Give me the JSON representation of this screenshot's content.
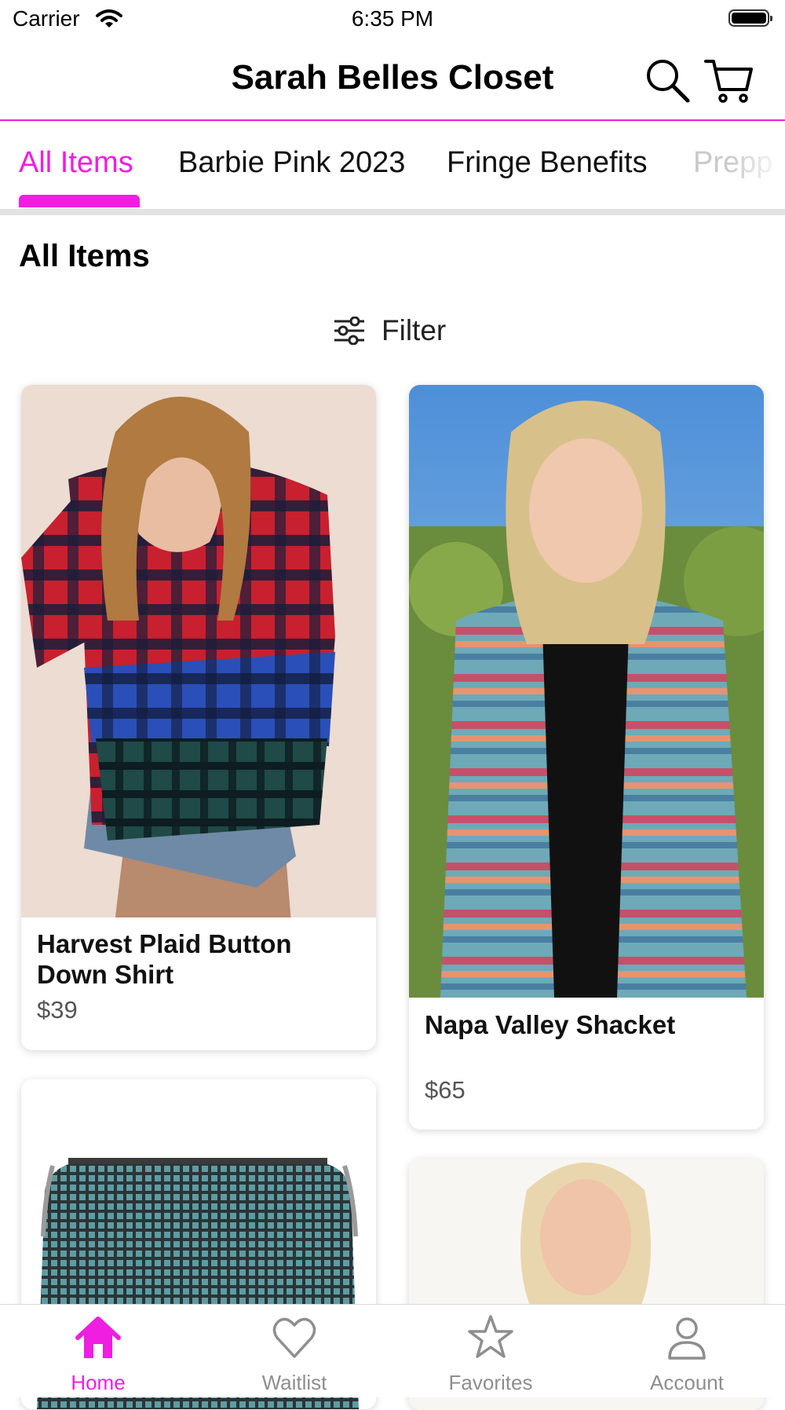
{
  "status_bar": {
    "carrier": "Carrier",
    "time": "6:35 PM"
  },
  "header": {
    "title": "Sarah Belles Closet",
    "icons": [
      "search-icon",
      "cart-icon"
    ]
  },
  "tabs": [
    {
      "label": "All Items",
      "active": true
    },
    {
      "label": "Barbie Pink 2023",
      "active": false
    },
    {
      "label": "Fringe Benefits",
      "active": false
    },
    {
      "label": "Prepp",
      "active": false
    }
  ],
  "section": {
    "title": "All Items",
    "filter_label": "Filter"
  },
  "products": [
    {
      "name": "Harvest Plaid Button Down Shirt",
      "price": "$39"
    },
    {
      "name": "Napa Valley Shacket",
      "price": "$65"
    }
  ],
  "nav": [
    {
      "label": "Home",
      "icon": "home-icon",
      "active": true
    },
    {
      "label": "Waitlist",
      "icon": "heart-icon",
      "active": false
    },
    {
      "label": "Favorites",
      "icon": "star-icon",
      "active": false
    },
    {
      "label": "Account",
      "icon": "person-icon",
      "active": false
    }
  ],
  "colors": {
    "accent": "#f01ee0",
    "inactive": "#8e8e8e",
    "divider": "#e2e2e2"
  }
}
